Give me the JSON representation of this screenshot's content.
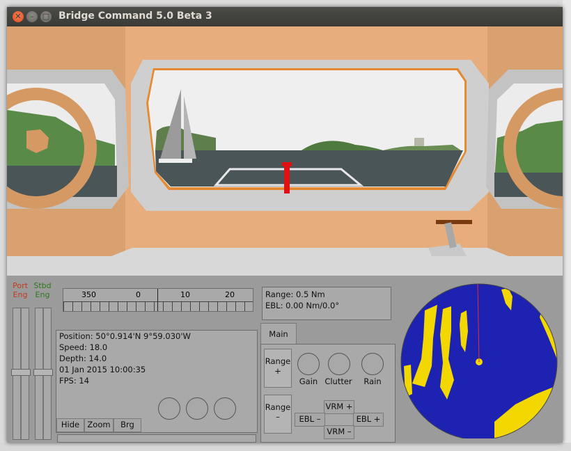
{
  "window": {
    "title": "Bridge Command 5.0 Beta 3"
  },
  "colors": {
    "radar_sea": "#1e22b0",
    "radar_land": "#f2d800",
    "bridge_frame": "#d9a16f",
    "sky": "#eeeeee",
    "water": "#4a5558"
  },
  "engines": {
    "port_label_1": "Port",
    "port_label_2": "Eng",
    "stbd_label_1": "Stbd",
    "stbd_label_2": "Eng"
  },
  "compass": {
    "ticks": [
      "350",
      "0",
      "10",
      "20"
    ]
  },
  "info": {
    "position": "Position: 50°0.914'N 9°59.030'W",
    "speed": "Speed: 18.0",
    "depth": "Depth: 14.0",
    "datetime": "01 Jan 2015 10:00:35",
    "fps": "FPS: 14"
  },
  "info_buttons": {
    "hide": "Hide",
    "zoom": "Zoom",
    "brg": "Brg"
  },
  "radar_info": {
    "range": "Range: 0.5 Nm",
    "ebl": "EBL: 0.00 Nm/0.0°"
  },
  "radar_tabs": {
    "main": "Main"
  },
  "radar_controls": {
    "range_plus_1": "Range",
    "range_plus_2": "+",
    "range_minus_1": "Range",
    "range_minus_2": "–",
    "gain": "Gain",
    "clutter": "Clutter",
    "rain": "Rain",
    "vrm_plus": "VRM +",
    "vrm_minus": "VRM –",
    "ebl_minus": "EBL –",
    "ebl_plus": "EBL +"
  }
}
